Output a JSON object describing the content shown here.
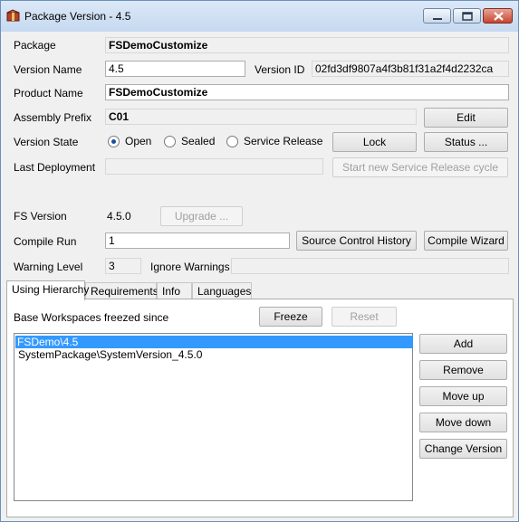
{
  "window": {
    "title": "Package Version - 4.5",
    "app_icon": "package-icon",
    "controls": [
      "minimize-icon",
      "maximize-icon",
      "close-icon"
    ]
  },
  "form": {
    "package_label": "Package",
    "package_value": "FSDemoCustomize",
    "version_name_label": "Version Name",
    "version_name_value": "4.5",
    "version_id_label": "Version ID",
    "version_id_value": "02fd3df9807a4f3b81f31a2f4d2232ca",
    "product_name_label": "Product Name",
    "product_name_value": "FSDemoCustomize",
    "assembly_prefix_label": "Assembly Prefix",
    "assembly_prefix_value": "C01",
    "edit_button": "Edit",
    "version_state_label": "Version State",
    "states": [
      "Open",
      "Sealed",
      "Service Release"
    ],
    "selected_state": "Open",
    "lock_button": "Lock",
    "status_button": "Status ...",
    "last_deployment_label": "Last Deployment",
    "last_deployment_value": "",
    "start_sr_button": "Start new Service Release cycle",
    "fs_version_label": "FS Version",
    "fs_version_value": "4.5.0",
    "upgrade_button": "Upgrade ...",
    "compile_run_label": "Compile Run",
    "compile_run_value": "1",
    "source_control_button": "Source Control History",
    "compile_wizard_button": "Compile Wizard",
    "warning_level_label": "Warning Level",
    "warning_level_value": "3",
    "ignore_warnings_label": "Ignore Warnings",
    "ignore_warnings_value": ""
  },
  "tabs": [
    "Using Hierarchy",
    "Requirements",
    "Info",
    "Languages"
  ],
  "active_tab": "Using Hierarchy",
  "hierarchy": {
    "freeze_label": "Base Workspaces freezed since",
    "freeze_button": "Freeze",
    "reset_button": "Reset",
    "items": [
      "FSDemo\\4.5",
      "SystemPackage\\SystemVersion_4.5.0"
    ],
    "selected_index": 0,
    "add_button": "Add",
    "remove_button": "Remove",
    "move_up_button": "Move up",
    "move_down_button": "Move down",
    "change_version_button": "Change Version"
  },
  "colors": {
    "selection": "#3399ff",
    "radio_dot": "#1a4f9c",
    "close_button": "#c8452f"
  }
}
